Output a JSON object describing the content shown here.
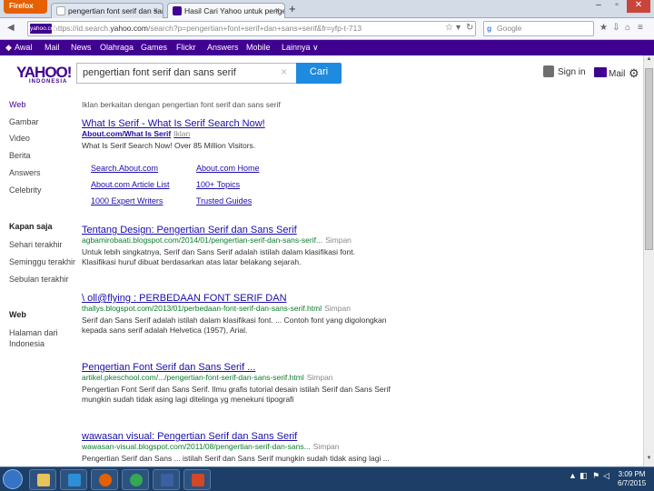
{
  "browser": {
    "menu_label": "Firefox",
    "tabs": [
      {
        "title": "pengertian font serif dan sans serif",
        "favicon": "google-g-icon"
      },
      {
        "title": "Hasil Cari Yahoo untuk pengertian fo...",
        "favicon": "yahoo-y-icon"
      }
    ],
    "url_domain": "yahoo.com",
    "url_prefix": "https://id.search.",
    "url_rest": "/search?p=pengertian+font+serif+dan+sans+serif&fr=yfp-t-713",
    "url_badge": "yahoo.com",
    "search_engine": "Google"
  },
  "yahoo_nav": [
    "Awal",
    "Mail",
    "News",
    "Olahraga",
    "Games",
    "Flickr",
    "Answers",
    "Mobile",
    "Lainnya ∨"
  ],
  "header": {
    "logo": "YAHOO!",
    "logo_sub": "INDONESIA",
    "search_value": "pengertian font serif dan sans serif",
    "search_button": "Cari",
    "signin": "Sign in",
    "mail": "Mail"
  },
  "sidebar": {
    "verticals": [
      "Web",
      "Gambar",
      "Video",
      "Berita",
      "Answers",
      "Celebrity"
    ],
    "time_head": "Kapan saja",
    "time_items": [
      "Sehari terakhir",
      "Seminggu terakhir",
      "Sebulan terakhir"
    ],
    "region_head": "Web",
    "region_items": [
      "Halaman dari",
      "Indonesia"
    ]
  },
  "ad_label": "Iklan berkaitan dengan pengertian font serif dan sans serif",
  "ad": {
    "title": "What Is Serif - What Is Serif Search Now!",
    "url": "About.com/What Is Serif",
    "url_tag": "Iklan",
    "desc": "What Is Serif Search Now! Over 85 Million Visitors.",
    "sitelinks": [
      "Search.About.com",
      "About.com Home",
      "About.com Article List",
      "100+ Topics",
      "1000 Expert Writers",
      "Trusted Guides"
    ]
  },
  "results": [
    {
      "title": "Tentang Design: Pengertian Serif dan Sans Serif",
      "url": "agbamirobaati.blogspot.com/2014/01/pengertian-serif-dan-sans-serif...",
      "cache": "Simpan",
      "desc1": "Untuk lebih singkatnya, Serif dan Sans Serif adalah istilah dalam klasifikasi font.",
      "desc2": "Klasifikasi huruf dibuat berdasarkan atas latar belakang sejarah."
    },
    {
      "title": "\\ oll@flying                    : PERBEDAAN FONT SERIF DAN",
      "url": "thallys.blogspot.com/2013/01/perbedaan-font-serif-dan-sans-serif.html",
      "cache": "Simpan",
      "desc1": "Serif dan Sans Serif adalah istilah dalam klasifikasi font. ... Contoh font yang digolongkan",
      "desc2": "kepada sans serif adalah Helvetica (1957), Arial."
    },
    {
      "title": "Pengertian Font Serif dan Sans Serif ...",
      "url": "artikel.pkeschool.com/.../pengertian-font-serif-dan-sans-serif.html",
      "cache": "Simpan",
      "desc1": "Pengertian Font Serif dan Sans Serif. Ilmu grafis tutorial desain istilah Serif dan Sans Serif",
      "desc2": "mungkin sudah tidak asing lagi ditelinga yg menekuni tipografi"
    },
    {
      "title": "wawasan visual: Pengertian Serif dan Sans Serif",
      "url": "wawasan-visual.blogspot.com/2011/08/pengertian-serif-dan-sans...",
      "cache": "Simpan",
      "desc1": "Pengertian Serif dan Sans ... istilah Serif dan Sans Serif mungkin sudah tidak asing lagi ...",
      "desc2": ""
    }
  ],
  "taskbar": {
    "time": "3:09 PM",
    "date": "6/7/2015"
  },
  "colors": {
    "yahoo_purple": "#400090",
    "link_blue": "#1a0dab",
    "url_green": "#0a7d2c",
    "search_button": "#1e8ae0",
    "firefox_orange": "#e66000"
  }
}
